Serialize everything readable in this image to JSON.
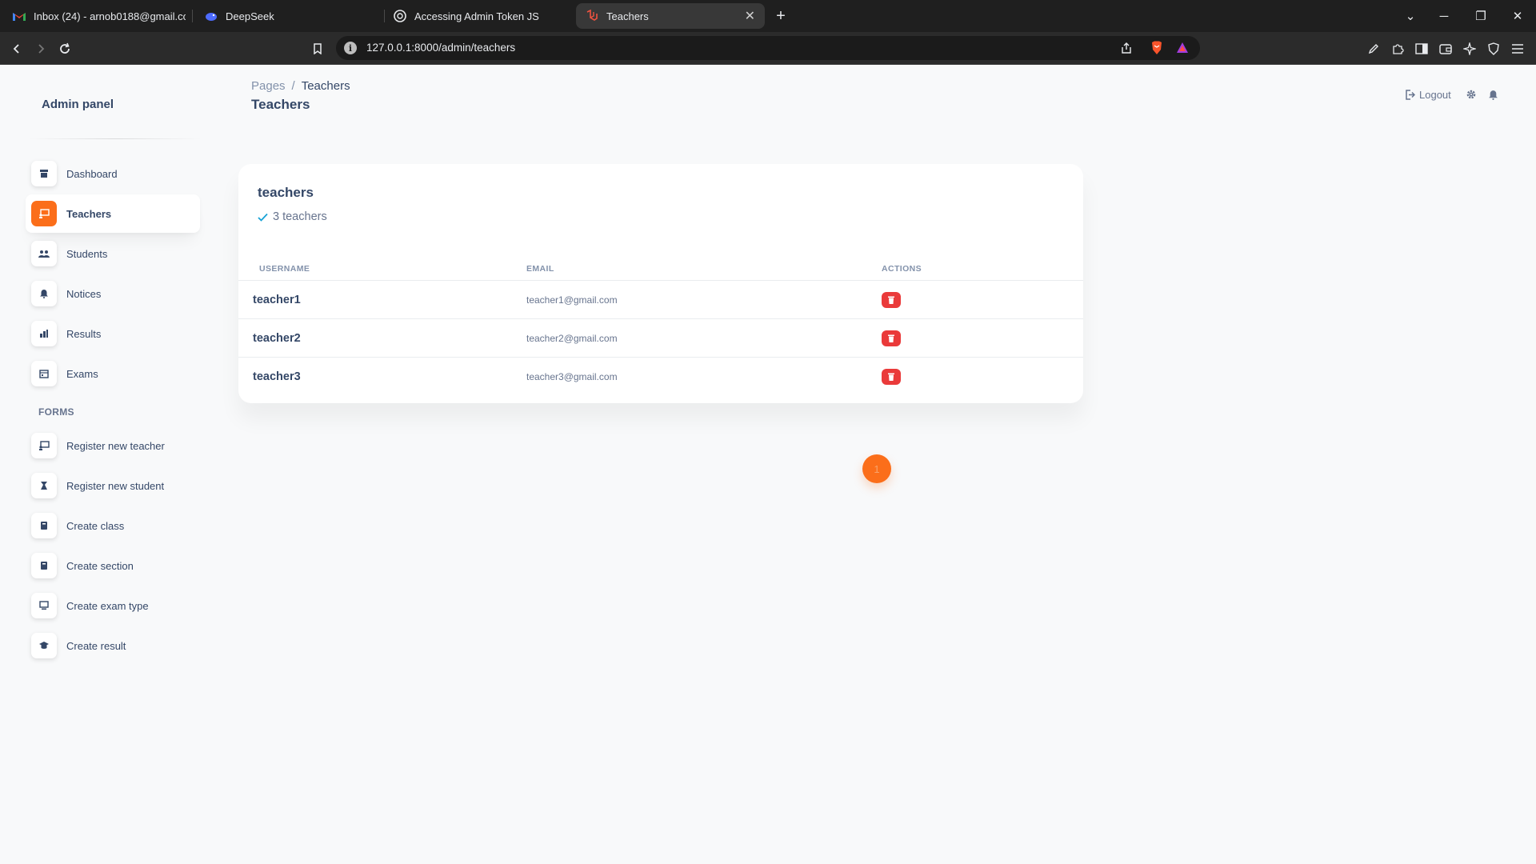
{
  "browser": {
    "tabs": [
      {
        "title": "Inbox (24) - arnob0188@gmail.com",
        "icon": "gmail-icon"
      },
      {
        "title": "DeepSeek",
        "icon": "deepseek-icon"
      },
      {
        "title": "Accessing Admin Token JS",
        "icon": "chatgpt-icon"
      },
      {
        "title": "Teachers",
        "icon": "laravel-icon",
        "active": true
      }
    ],
    "url": "127.0.0.1:8000/admin/teachers"
  },
  "sidebar": {
    "brand": "Admin panel",
    "items": [
      {
        "label": "Dashboard",
        "icon": "shop-icon"
      },
      {
        "label": "Teachers",
        "icon": "teacher-icon",
        "active": true
      },
      {
        "label": "Students",
        "icon": "students-icon"
      },
      {
        "label": "Notices",
        "icon": "bell-icon"
      },
      {
        "label": "Results",
        "icon": "chart-icon"
      },
      {
        "label": "Exams",
        "icon": "calendar-icon"
      }
    ],
    "forms_heading": "FORMS",
    "forms": [
      {
        "label": "Register new teacher",
        "icon": "teacher-icon"
      },
      {
        "label": "Register new student",
        "icon": "student-icon"
      },
      {
        "label": "Create class",
        "icon": "book-icon"
      },
      {
        "label": "Create section",
        "icon": "book-icon"
      },
      {
        "label": "Create exam type",
        "icon": "monitor-icon"
      },
      {
        "label": "Create result",
        "icon": "graduation-cap-icon"
      }
    ]
  },
  "header": {
    "breadcrumb": [
      "Pages",
      "Teachers"
    ],
    "breadcrumb_sep": "/",
    "title": "Teachers",
    "logout_label": "Logout"
  },
  "card": {
    "title": "teachers",
    "subtitle": "3 teachers",
    "columns": [
      "USERNAME",
      "EMAIL",
      "ACTIONS"
    ],
    "rows": [
      {
        "username": "teacher1",
        "email": "teacher1@gmail.com"
      },
      {
        "username": "teacher2",
        "email": "teacher2@gmail.com"
      },
      {
        "username": "teacher3",
        "email": "teacher3@gmail.com"
      }
    ]
  },
  "pagination": {
    "current": "1"
  },
  "colors": {
    "accent": "#fb6e1a",
    "danger": "#ea3a3a",
    "text": "#344767",
    "muted": "#67748e"
  }
}
